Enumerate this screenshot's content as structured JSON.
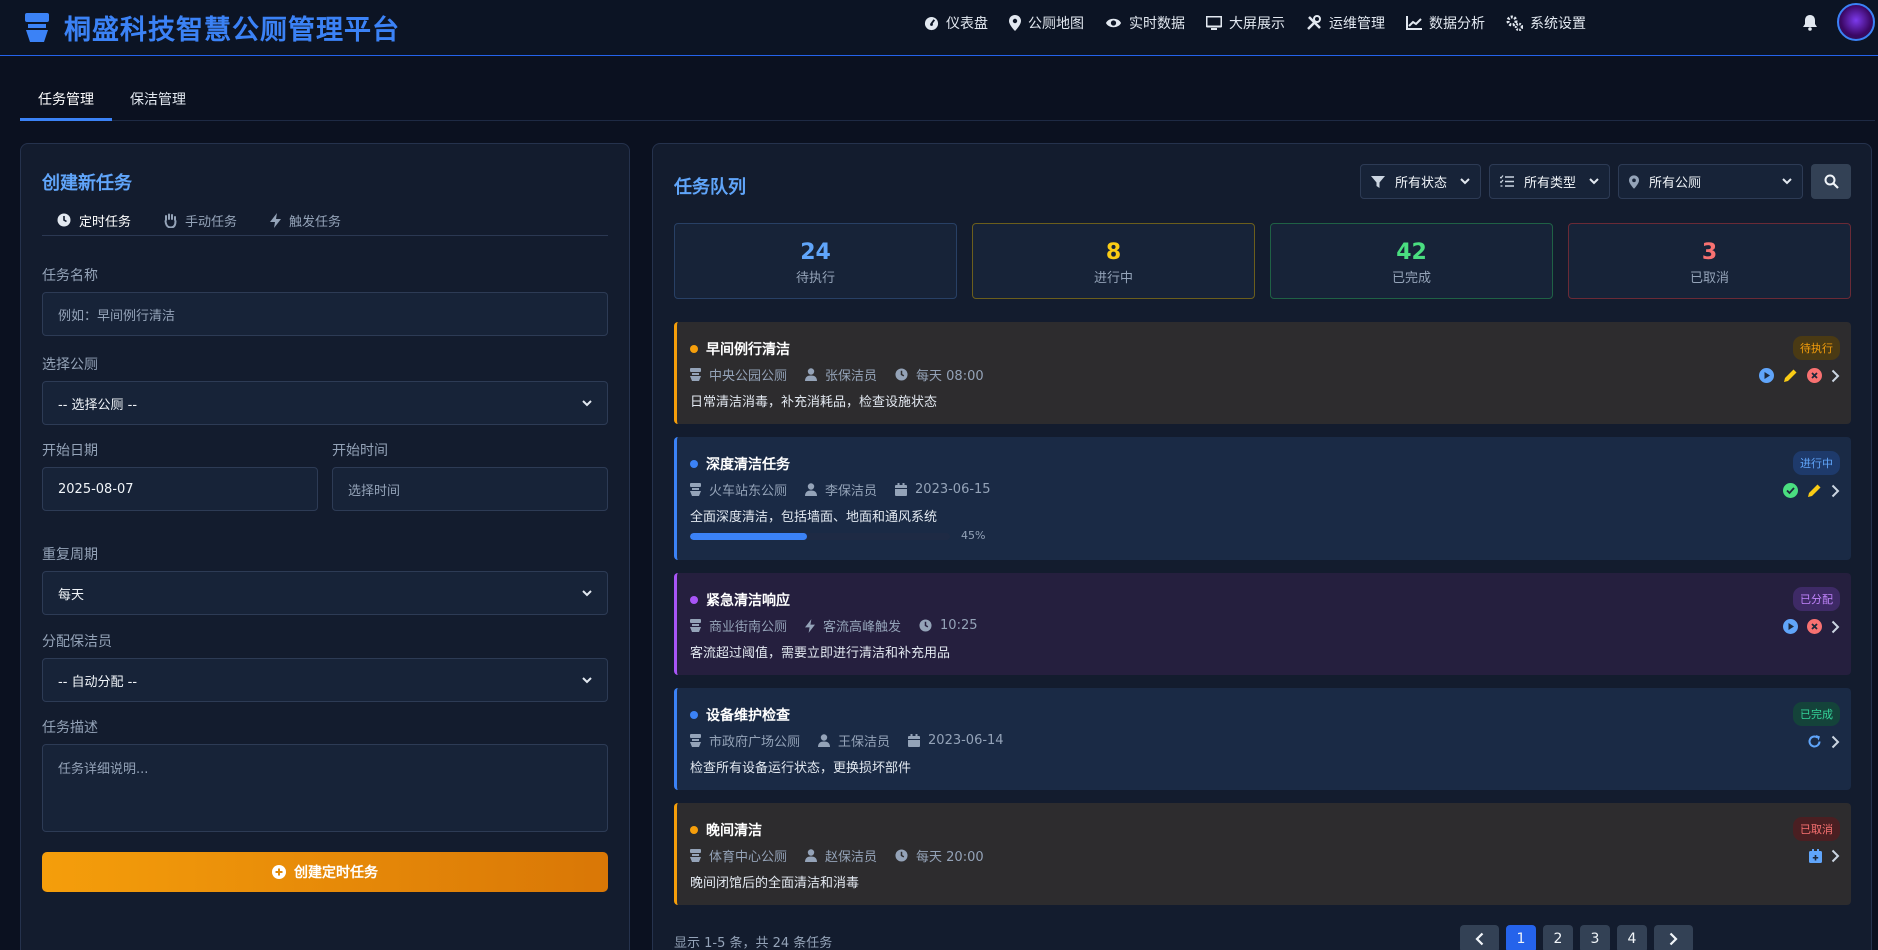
{
  "app": {
    "title": "桐盛科技智慧公厕管理平台"
  },
  "nav": [
    {
      "label": "仪表盘",
      "icon": "gauge-icon"
    },
    {
      "label": "公厕地图",
      "icon": "map-pin-icon"
    },
    {
      "label": "实时数据",
      "icon": "eye-icon"
    },
    {
      "label": "大屏展示",
      "icon": "monitor-icon"
    },
    {
      "label": "运维管理",
      "icon": "tools-icon"
    },
    {
      "label": "数据分析",
      "icon": "chart-line-icon"
    },
    {
      "label": "系统设置",
      "icon": "gears-icon"
    }
  ],
  "tabs": [
    {
      "label": "任务管理",
      "active": true
    },
    {
      "label": "保洁管理",
      "active": false
    }
  ],
  "create": {
    "title": "创建新任务",
    "subtabs": [
      {
        "label": "定时任务",
        "icon": "clock-icon",
        "active": true
      },
      {
        "label": "手动任务",
        "icon": "hand-icon",
        "active": false
      },
      {
        "label": "触发任务",
        "icon": "bolt-icon",
        "active": false
      }
    ],
    "name_label": "任务名称",
    "name_placeholder": "例如：早间例行清洁",
    "toilet_label": "选择公厕",
    "toilet_value": "-- 选择公厕 --",
    "date_label": "开始日期",
    "date_value": "2025-08-07",
    "time_label": "开始时间",
    "time_placeholder": "选择时间",
    "repeat_label": "重复周期",
    "repeat_value": "每天",
    "cleaner_label": "分配保洁员",
    "cleaner_value": "-- 自动分配 --",
    "desc_label": "任务描述",
    "desc_placeholder": "任务详细说明...",
    "submit_label": "创建定时任务"
  },
  "queue": {
    "title": "任务队列",
    "filters": {
      "status": "所有状态",
      "type": "所有类型",
      "toilet": "所有公厕"
    },
    "stats": [
      {
        "value": "24",
        "label": "待执行",
        "color": "#60a5fa"
      },
      {
        "value": "8",
        "label": "进行中",
        "color": "#facc15"
      },
      {
        "value": "42",
        "label": "已完成",
        "color": "#4ade80"
      },
      {
        "value": "3",
        "label": "已取消",
        "color": "#f87171"
      }
    ],
    "tasks": [
      {
        "title": "早间例行清洁",
        "location": "中央公园公厕",
        "person": "张保洁员",
        "time": "每天 08:00",
        "desc": "日常清洁消毒，补充消耗品，检查设施状态",
        "status": "待执行"
      },
      {
        "title": "深度清洁任务",
        "location": "火车站东公厕",
        "person": "李保洁员",
        "time": "2023-06-15",
        "desc": "全面深度清洁，包括墙面、地面和通风系统",
        "status": "进行中",
        "progress": 45,
        "progress_label": "45%"
      },
      {
        "title": "紧急清洁响应",
        "location": "商业街南公厕",
        "person": "客流高峰触发",
        "time": "10:25",
        "desc": "客流超过阈值，需要立即进行清洁和补充用品",
        "status": "已分配"
      },
      {
        "title": "设备维护检查",
        "location": "市政府广场公厕",
        "person": "王保洁员",
        "time": "2023-06-14",
        "desc": "检查所有设备运行状态，更换损坏部件",
        "status": "已完成"
      },
      {
        "title": "晚间清洁",
        "location": "体育中心公厕",
        "person": "赵保洁员",
        "time": "每天 20:00",
        "desc": "晚间闭馆后的全面清洁和消毒",
        "status": "已取消"
      }
    ],
    "footer": "显示 1-5 条，共 24 条任务",
    "pages": [
      "1",
      "2",
      "3",
      "4"
    ]
  }
}
